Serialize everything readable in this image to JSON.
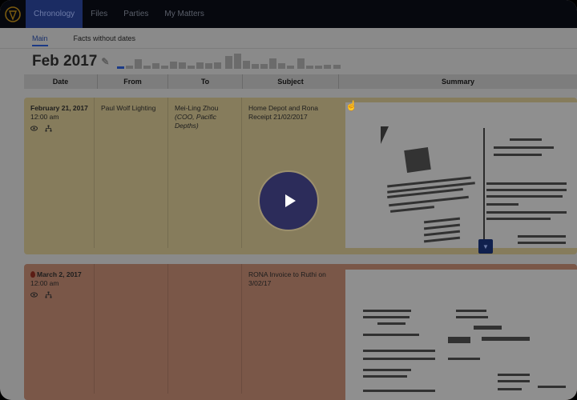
{
  "nav": {
    "tabs": [
      {
        "label": "Chronology"
      },
      {
        "label": "Files"
      },
      {
        "label": "Parties"
      },
      {
        "label": "My Matters"
      }
    ]
  },
  "subtabs": [
    {
      "label": "Main"
    },
    {
      "label": "Facts without dates"
    }
  ],
  "month_header": {
    "label": "Feb 2017"
  },
  "columns": {
    "date": "Date",
    "from": "From",
    "to": "To",
    "subject": "Subject",
    "summary": "Summary"
  },
  "rows": [
    {
      "date": "February 21, 2017",
      "time": "12:00 am",
      "from": "Paul Wolf Lighting",
      "to_name": "Mei-Ling Zhou",
      "to_role": "(COO, Pacific Depths)",
      "subject": "Home Depot and Rona Receipt 21/02/2017"
    },
    {
      "date": "March 2, 2017",
      "time": "12:00 am",
      "from": "",
      "to_name": "",
      "to_role": "",
      "subject": "RONA Invoice to Ruthi on 3/02/17"
    }
  ],
  "colors": {
    "nav_bg": "#06080e",
    "active_tab": "#1b2c63",
    "row1_bg": "#867c5c",
    "row2_bg": "#7a5748",
    "accent": "#1b3a86"
  },
  "icons": {
    "logo": "shield-logo-icon",
    "eye": "eye-icon",
    "hierarchy": "hierarchy-icon",
    "pencil": "pencil-icon",
    "play": "play-icon",
    "cursor": "hand-cursor-icon",
    "expand": "chevron-down-icon"
  }
}
